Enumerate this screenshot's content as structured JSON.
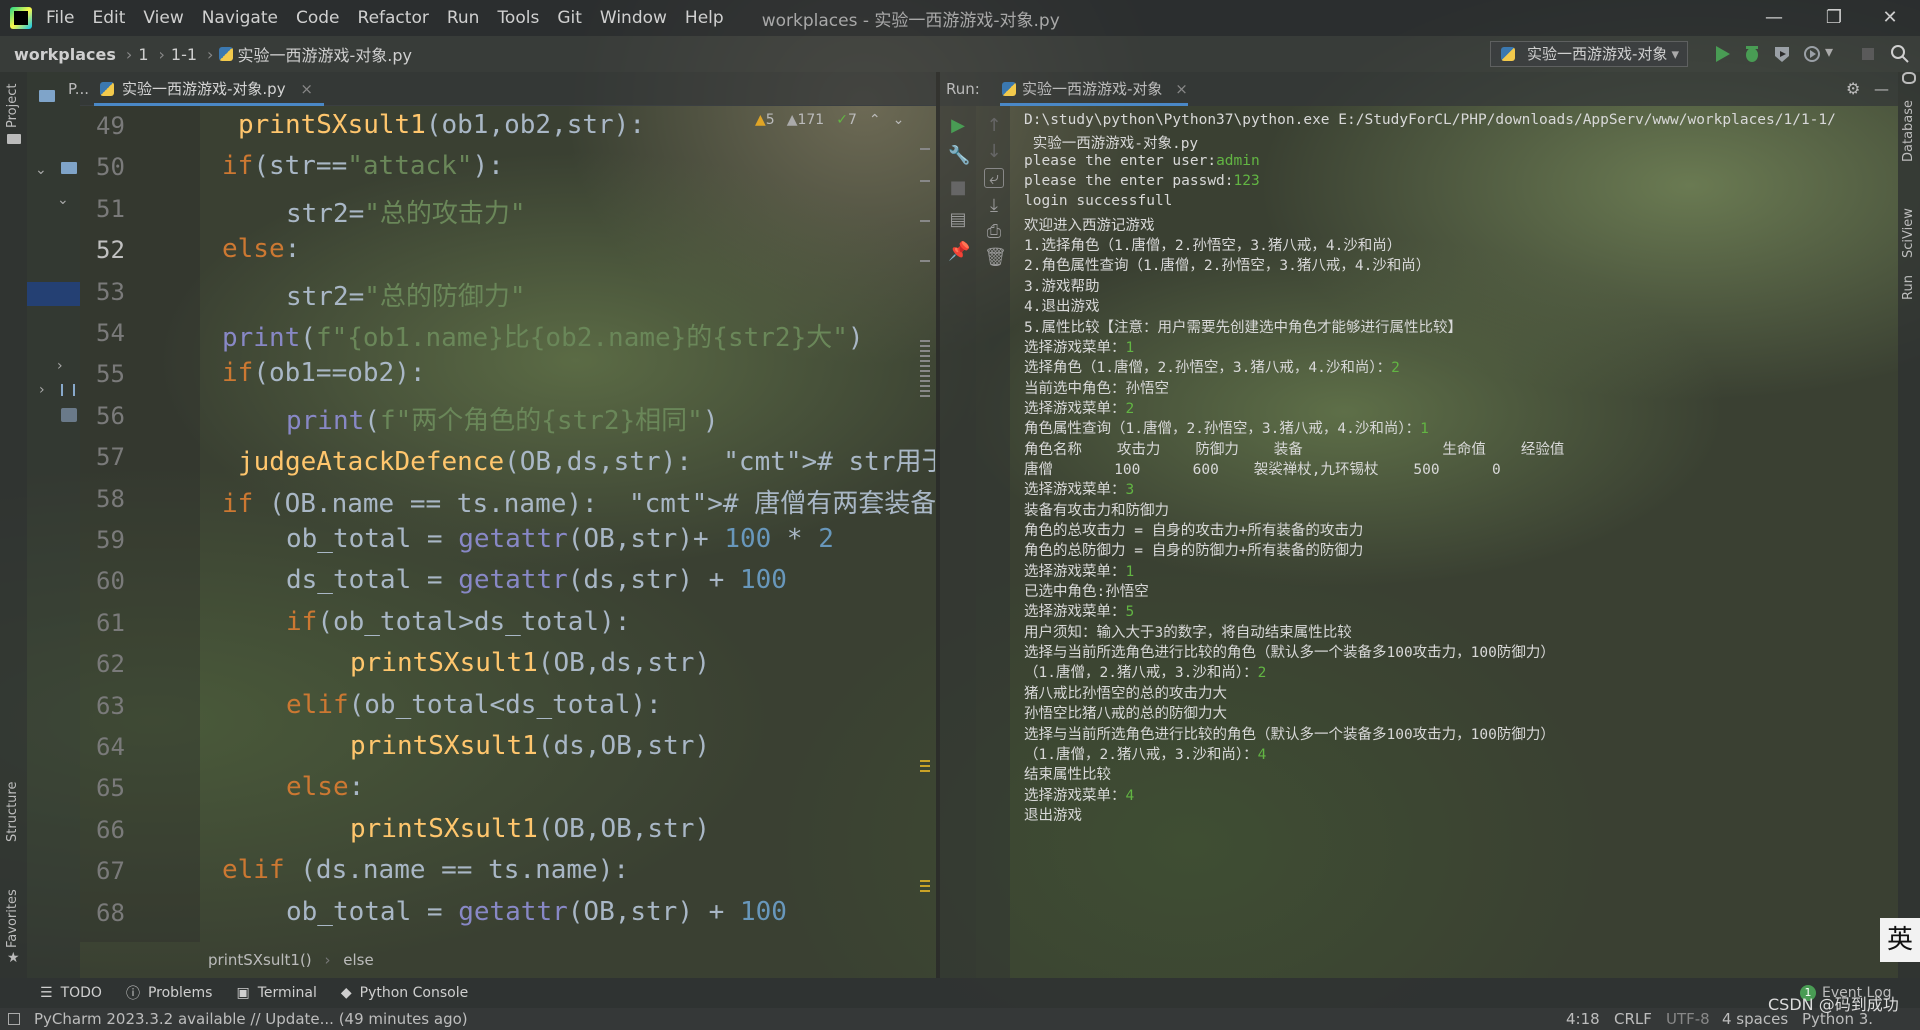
{
  "menu": [
    "File",
    "Edit",
    "View",
    "Navigate",
    "Code",
    "Refactor",
    "Run",
    "Tools",
    "Git",
    "Window",
    "Help"
  ],
  "window_title": "workplaces - 实验一西游游戏-对象.py",
  "nav": {
    "project": "workplaces",
    "folder1": "1",
    "folder2": "1-1",
    "file": "实验一西游游戏-对象.py",
    "run_config": "实验一西游游戏-对象"
  },
  "sidebar": {
    "project_label": "Project",
    "structure_label": "Structure",
    "favorites_label": "Favorites"
  },
  "editor": {
    "tab_project": "P...",
    "tab_file": "实验一西游游戏-对象.py",
    "inspections": {
      "warnings": "5",
      "weak_warnings": "171",
      "typos": "7"
    },
    "current_line": "52",
    "breadcrumb": [
      "printSXsult1()",
      "else"
    ]
  },
  "code_lines": [
    {
      "n": "49",
      "t": "printSXsult1(ob1,ob2,str):"
    },
    {
      "n": "50",
      "t": "if(str==\"attack\"):"
    },
    {
      "n": "51",
      "t": "str2=\"总的攻击力\""
    },
    {
      "n": "52",
      "t": "else:"
    },
    {
      "n": "53",
      "t": "str2=\"总的防御力\""
    },
    {
      "n": "54",
      "t": "print(f\"{ob1.name}比{ob2.name}的{str2}大\")"
    },
    {
      "n": "55",
      "t": "if(ob1==ob2):"
    },
    {
      "n": "56",
      "t": "print(f\"两个角色的{str2}相同\")"
    },
    {
      "n": "57",
      "t": "judgeAtackDefence(OB,ds,str):  # str用于决定"
    },
    {
      "n": "58",
      "t": "if (OB.name == ts.name):  # 唐僧有两套装备"
    },
    {
      "n": "59",
      "t": "ob_total = getattr(OB,str)+ 100 * 2"
    },
    {
      "n": "60",
      "t": "ds_total = getattr(ds,str) + 100"
    },
    {
      "n": "61",
      "t": "if(ob_total>ds_total):"
    },
    {
      "n": "62",
      "t": "printSXsult1(OB,ds,str)"
    },
    {
      "n": "63",
      "t": "elif(ob_total<ds_total):"
    },
    {
      "n": "64",
      "t": "printSXsult1(ds,OB,str)"
    },
    {
      "n": "65",
      "t": "else:"
    },
    {
      "n": "66",
      "t": "printSXsult1(OB,OB,str)"
    },
    {
      "n": "67",
      "t": "elif (ds.name == ts.name):"
    },
    {
      "n": "68",
      "t": "ob_total = getattr(OB,str) + 100"
    }
  ],
  "run": {
    "label": "Run:",
    "tab": "实验一西游游戏-对象",
    "console": [
      {
        "t": "D:\\study\\python\\Python37\\python.exe E:/StudyForCL/PHP/downloads/AppServ/www/workplaces/1/1-1/"
      },
      {
        "t": " 实验一西游游戏-对象.py"
      },
      {
        "t": "please the enter user:",
        "in": "admin"
      },
      {
        "t": "please the enter passwd:",
        "in": "123"
      },
      {
        "t": "login successfull"
      },
      {
        "t": "欢迎进入西游记游戏"
      },
      {
        "t": "1.选择角色（1.唐僧，2.孙悟空，3.猪八戒，4.沙和尚）"
      },
      {
        "t": "2.角色属性查询（1.唐僧，2.孙悟空，3.猪八戒，4.沙和尚）"
      },
      {
        "t": "3.游戏帮助"
      },
      {
        "t": "4.退出游戏"
      },
      {
        "t": "5.属性比较【注意：用户需要先创建选中角色才能够进行属性比较】"
      },
      {
        "t": "选择游戏菜单：",
        "in": "1"
      },
      {
        "t": "选择角色（1.唐僧，2.孙悟空，3.猪八戒，4.沙和尚）：",
        "in": "2"
      },
      {
        "t": "当前选中角色：孙悟空"
      },
      {
        "t": "选择游戏菜单：",
        "in": "2"
      },
      {
        "t": "角色属性查询（1.唐僧，2.孙悟空，3.猪八戒，4.沙和尚）：",
        "in": "1"
      },
      {
        "t": "角色名称    攻击力    防御力    装备                生命值    经验值"
      },
      {
        "t": "唐僧       100      600    袈裟禅杖,九环锡杖    500      0"
      },
      {
        "t": "选择游戏菜单：",
        "in": "3"
      },
      {
        "t": "装备有攻击力和防御力"
      },
      {
        "t": "角色的总攻击力 = 自身的攻击力+所有装备的攻击力"
      },
      {
        "t": "角色的总防御力 = 自身的防御力+所有装备的防御力"
      },
      {
        "t": "选择游戏菜单：",
        "in": "1"
      },
      {
        "t": "已选中角色:孙悟空"
      },
      {
        "t": "选择游戏菜单：",
        "in": "5"
      },
      {
        "t": "用户须知：输入大于3的数字，将自动结束属性比较"
      },
      {
        "t": "选择与当前所选角色进行比较的角色（默认多一个装备多100攻击力，100防御力）"
      },
      {
        "t": "（1.唐僧，2.猪八戒，3.沙和尚）：",
        "in": "2"
      },
      {
        "t": "猪八戒比孙悟空的总的攻击力大"
      },
      {
        "t": "孙悟空比猪八戒的总的防御力大"
      },
      {
        "t": "选择与当前所选角色进行比较的角色（默认多一个装备多100攻击力，100防御力）"
      },
      {
        "t": "（1.唐僧，2.猪八戒，3.沙和尚）：",
        "in": "4"
      },
      {
        "t": "结束属性比较"
      },
      {
        "t": "选择游戏菜单：",
        "in": "4"
      },
      {
        "t": "退出游戏"
      }
    ]
  },
  "right_strip": [
    "Database",
    "SciView",
    "Run"
  ],
  "bottom_tabs": [
    "TODO",
    "Problems",
    "Terminal",
    "Python Console"
  ],
  "event_log": "Event Log",
  "event_count": "1",
  "status": {
    "message": "PyCharm 2023.3.2 available // Update... (49 minutes ago)",
    "position": "4:18",
    "line_sep": "CRLF",
    "encoding": "UTF-8",
    "indent": "4 spaces",
    "interpreter": "Python 3.",
    "watermark": "CSDN @码到成功"
  },
  "ime_label": "英",
  "colors": {
    "keyword": "#cc7832",
    "string": "#6a8759",
    "function": "#ffc66d",
    "number": "#6897bb",
    "user_input": "#62b543"
  }
}
